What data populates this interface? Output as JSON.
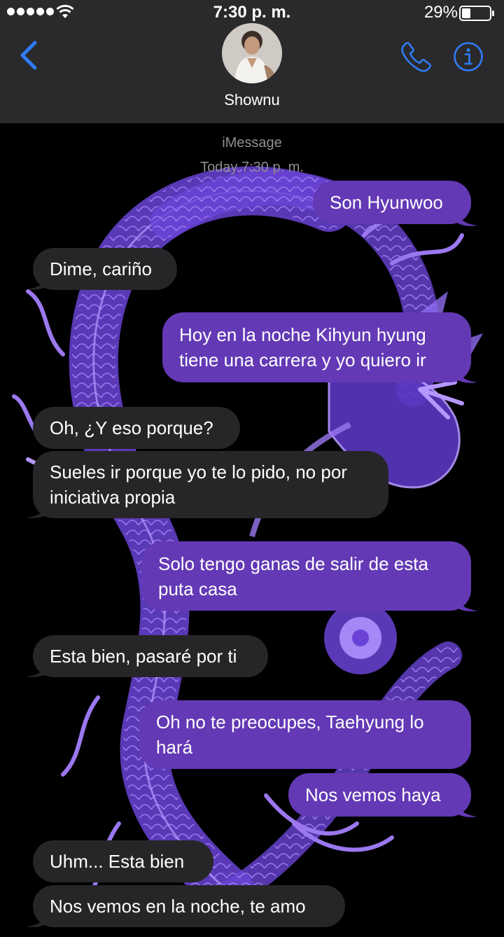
{
  "status_bar": {
    "time": "7:30 p. m.",
    "battery": "29%"
  },
  "contact": {
    "name": "Shownu"
  },
  "thread": {
    "service": "iMessage",
    "timestamp": "Today 7:30 p. m."
  },
  "messages": [
    {
      "from": "me",
      "text": "Son Hyunwoo"
    },
    {
      "from": "them",
      "text": "Dime, cariño"
    },
    {
      "from": "me",
      "text": "Hoy en la noche Kihyun hyung tiene una carrera y yo quiero ir"
    },
    {
      "from": "them",
      "text": "Oh, ¿Y eso porque?"
    },
    {
      "from": "them",
      "text": "Sueles ir porque yo te lo pido, no por iniciativa propia"
    },
    {
      "from": "me",
      "text": "Solo tengo ganas de salir de esta puta casa"
    },
    {
      "from": "them",
      "text": "Esta bien, pasaré por ti"
    },
    {
      "from": "me",
      "text": "Oh no te preocupes, Taehyung lo hará"
    },
    {
      "from": "me",
      "text": "Nos vemos haya"
    },
    {
      "from": "them",
      "text": "Uhm... Esta bien"
    },
    {
      "from": "them",
      "text": "Nos vemos en la noche, te amo"
    }
  ],
  "icons": {
    "back": "chevron-left-icon",
    "call": "phone-icon",
    "info": "info-icon",
    "wifi": "wifi-icon",
    "battery": "battery-icon"
  },
  "colors": {
    "accent": "#2f7cf6",
    "sent_bubble": "#6339b5",
    "received_bubble": "#262628",
    "header_bg": "#2a2a2c",
    "wallpaper_dragon": "#7b52e6"
  }
}
